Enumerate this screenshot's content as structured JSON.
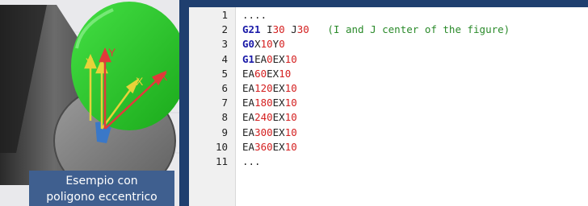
{
  "figure": {
    "caption_line1": "Esempio con",
    "caption_line2": "poligono eccentrico",
    "axis_labels": {
      "y_yellow": "Y",
      "y_red": "Y",
      "x_yellow": "X",
      "x_red": "X"
    },
    "colors": {
      "background": "#e9e9ec",
      "disc": "#2ecc2e",
      "axis_yellow": "#e8d23a",
      "axis_red": "#e23a3a",
      "caption_bg": "#3f5f8f"
    }
  },
  "code": {
    "lines": [
      {
        "num": "1",
        "tokens": [
          {
            "t": "....",
            "c": "plain"
          }
        ]
      },
      {
        "num": "2",
        "tokens": [
          {
            "t": "G21",
            "c": "kw"
          },
          {
            "t": " I",
            "c": "plain"
          },
          {
            "t": "30",
            "c": "num"
          },
          {
            "t": " J",
            "c": "plain"
          },
          {
            "t": "30",
            "c": "num"
          },
          {
            "t": "   (I and J center of the figure)",
            "c": "comment"
          }
        ]
      },
      {
        "num": "3",
        "tokens": [
          {
            "t": "G0",
            "c": "kw"
          },
          {
            "t": "X",
            "c": "plain"
          },
          {
            "t": "10",
            "c": "num"
          },
          {
            "t": "Y",
            "c": "plain"
          },
          {
            "t": "0",
            "c": "num"
          }
        ]
      },
      {
        "num": "4",
        "tokens": [
          {
            "t": "G1",
            "c": "kw"
          },
          {
            "t": "EA",
            "c": "plain"
          },
          {
            "t": "0",
            "c": "num"
          },
          {
            "t": "EX",
            "c": "plain"
          },
          {
            "t": "10",
            "c": "num"
          }
        ]
      },
      {
        "num": "5",
        "tokens": [
          {
            "t": "EA",
            "c": "plain"
          },
          {
            "t": "60",
            "c": "num"
          },
          {
            "t": "EX",
            "c": "plain"
          },
          {
            "t": "10",
            "c": "num"
          }
        ]
      },
      {
        "num": "6",
        "tokens": [
          {
            "t": "EA",
            "c": "plain"
          },
          {
            "t": "120",
            "c": "num"
          },
          {
            "t": "EX",
            "c": "plain"
          },
          {
            "t": "10",
            "c": "num"
          }
        ]
      },
      {
        "num": "7",
        "tokens": [
          {
            "t": "EA",
            "c": "plain"
          },
          {
            "t": "180",
            "c": "num"
          },
          {
            "t": "EX",
            "c": "plain"
          },
          {
            "t": "10",
            "c": "num"
          }
        ]
      },
      {
        "num": "8",
        "tokens": [
          {
            "t": "EA",
            "c": "plain"
          },
          {
            "t": "240",
            "c": "num"
          },
          {
            "t": "EX",
            "c": "plain"
          },
          {
            "t": "10",
            "c": "num"
          }
        ]
      },
      {
        "num": "9",
        "tokens": [
          {
            "t": "EA",
            "c": "plain"
          },
          {
            "t": "300",
            "c": "num"
          },
          {
            "t": "EX",
            "c": "plain"
          },
          {
            "t": "10",
            "c": "num"
          }
        ]
      },
      {
        "num": "10",
        "tokens": [
          {
            "t": "EA",
            "c": "plain"
          },
          {
            "t": "360",
            "c": "num"
          },
          {
            "t": "EX",
            "c": "plain"
          },
          {
            "t": "10",
            "c": "num"
          }
        ]
      },
      {
        "num": "11",
        "tokens": [
          {
            "t": "...",
            "c": "plain"
          }
        ]
      }
    ],
    "colors": {
      "keyword": "#1a1aa8",
      "number": "#d42020",
      "comment": "#2a8a2a",
      "text": "#222222",
      "gutter_bg": "#f0f0f0",
      "frame": "#1f3f6f"
    }
  }
}
